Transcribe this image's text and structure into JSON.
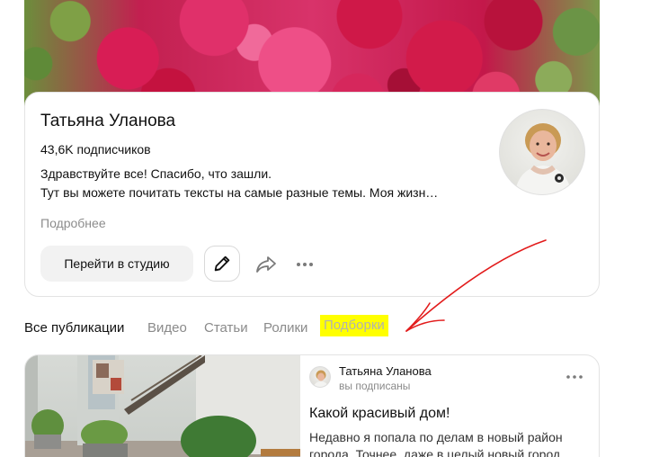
{
  "profile": {
    "name": "Татьяна Уланова",
    "subscribers": "43,6K подписчиков",
    "bio_line1": "Здравствуйте все! Спасибо, что зашли.",
    "bio_line2": "Тут вы можете почитать тексты на самые разные темы. Моя жизн…",
    "more_label": "Подробнее",
    "studio_button": "Перейти в студию"
  },
  "icons": {
    "edit": "pencil-icon",
    "share": "share-icon",
    "more": "more-dots-icon"
  },
  "tabs": [
    {
      "label": "Все публикации",
      "active": true
    },
    {
      "label": "Видео",
      "active": false
    },
    {
      "label": "Статьи",
      "active": false
    },
    {
      "label": "Ролики",
      "active": false
    },
    {
      "label": "Подборки",
      "active": false,
      "highlighted": true
    }
  ],
  "colors": {
    "highlight": "#ffff00",
    "annotation_arrow": "#e21b1b"
  },
  "post": {
    "author": "Татьяна Уланова",
    "subscription_status": "вы подписаны",
    "title": "Какой красивый дом!",
    "text_line1": "Недавно я попала по делам в новый район",
    "text_line2": "города. Точнее, даже в целый новый город"
  }
}
